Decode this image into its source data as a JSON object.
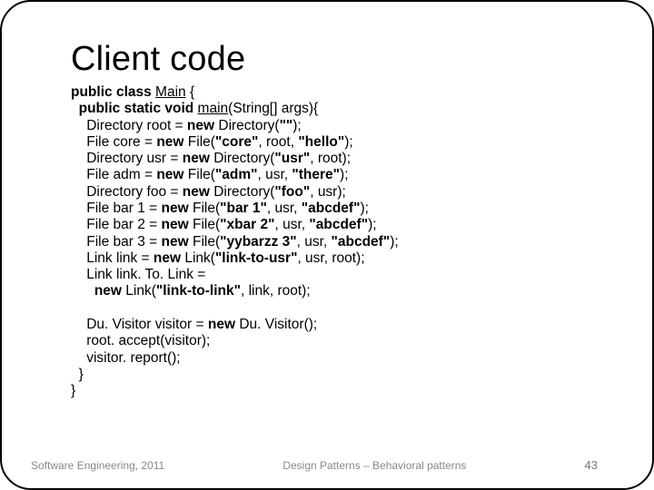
{
  "title": "Client code",
  "code_html": "<b>public class</b> <u>Main</u> {\n  <b>public static void</b> <u>main</u>(String[] args){\n    Directory root = <b>new</b> Directory(<b>\"\"</b>);\n    File core = <b>new</b> File(<b>\"core\"</b>, root, <b>\"hello\"</b>);\n    Directory usr = <b>new</b> Directory(<b>\"usr\"</b>, root);\n    File adm = <b>new</b> File(<b>\"adm\"</b>, usr, <b>\"there\"</b>);\n    Directory foo = <b>new</b> Directory(<b>\"foo\"</b>, usr);\n    File bar 1 = <b>new</b> File(<b>\"bar 1\"</b>, usr, <b>\"abcdef\"</b>);\n    File bar 2 = <b>new</b> File(<b>\"xbar 2\"</b>, usr, <b>\"abcdef\"</b>);\n    File bar 3 = <b>new</b> File(<b>\"yybarzz 3\"</b>, usr, <b>\"abcdef\"</b>);\n    Link link = <b>new</b> Link(<b>\"link-to-usr\"</b>, usr, root);\n    Link link. To. Link =\n      <b>new</b> Link(<b>\"link-to-link\"</b>, link, root);\n\n    Du. Visitor visitor = <b>new</b> Du. Visitor();\n    root. accept(visitor);\n    visitor. report();\n  }\n}",
  "footer": {
    "left": "Software Engineering, 2011",
    "center": "Design Patterns – Behavioral patterns",
    "right": "43"
  }
}
